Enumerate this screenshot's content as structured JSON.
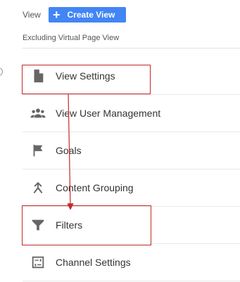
{
  "header": {
    "view_label": "View",
    "create_view_label": "Create View",
    "create_view_icon": "plus-icon",
    "view_name": "Excluding Virtual Page View"
  },
  "menu": {
    "items": [
      {
        "label": "View Settings",
        "icon": "document-icon"
      },
      {
        "label": "View User Management",
        "icon": "people-icon"
      },
      {
        "label": "Goals",
        "icon": "flag-icon"
      },
      {
        "label": "Content Grouping",
        "icon": "content-grouping-icon"
      },
      {
        "label": "Filters",
        "icon": "filter-icon"
      },
      {
        "label": "Channel Settings",
        "icon": "channel-settings-icon"
      }
    ]
  },
  "annotations": {
    "highlight_color": "#c62828",
    "highlighted_items": [
      "View Settings",
      "Filters"
    ],
    "arrow": {
      "from": "View Settings",
      "to": "Filters"
    }
  },
  "colors": {
    "accent": "#4285f4",
    "icon_gray": "#666666"
  }
}
